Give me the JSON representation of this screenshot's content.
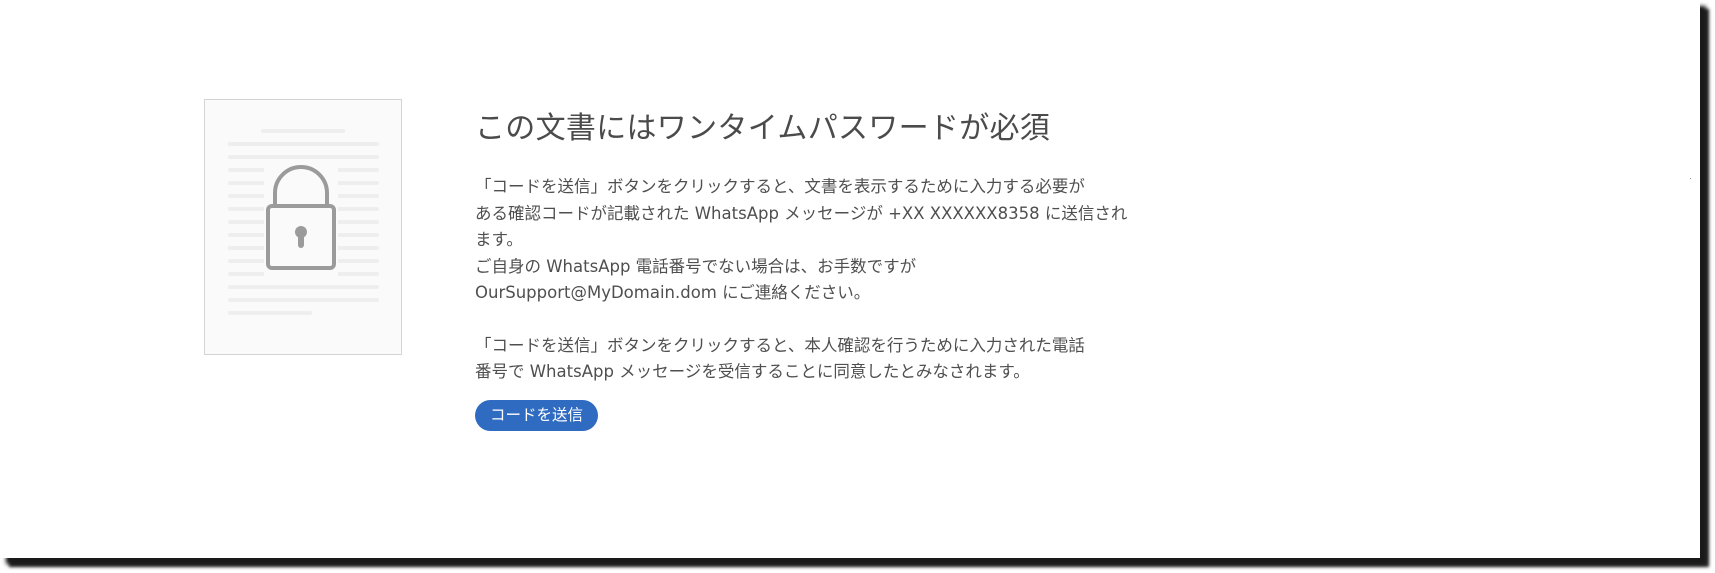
{
  "dialog": {
    "title": "この文書にはワンタイムパスワードが必須",
    "paragraph1": [
      "「コードを送信」ボタンをクリックすると、文書を表示するために入力する必要が",
      "ある確認コードが記載された WhatsApp メッセージが +XX XXXXXX8358 に送信され",
      "ます。",
      "ご自身の WhatsApp 電話番号でない場合は、お手数ですが",
      "OurSupport@MyDomain.dom にご連絡ください。"
    ],
    "paragraph2": [
      "「コードを送信」ボタンをクリックすると、本人確認を行うために入力された電話",
      "番号で WhatsApp メッセージを受信することに同意したとみなされます。"
    ],
    "send_button_label": "コードを送信"
  },
  "icons": {
    "document_icon": "locked-document-icon",
    "lock_icon": "padlock-icon"
  },
  "colors": {
    "accent": "#2f6bc1",
    "title_text": "#4b4b4b",
    "body_text": "#4f4f4f",
    "icon_gray": "#9b9b9b"
  }
}
